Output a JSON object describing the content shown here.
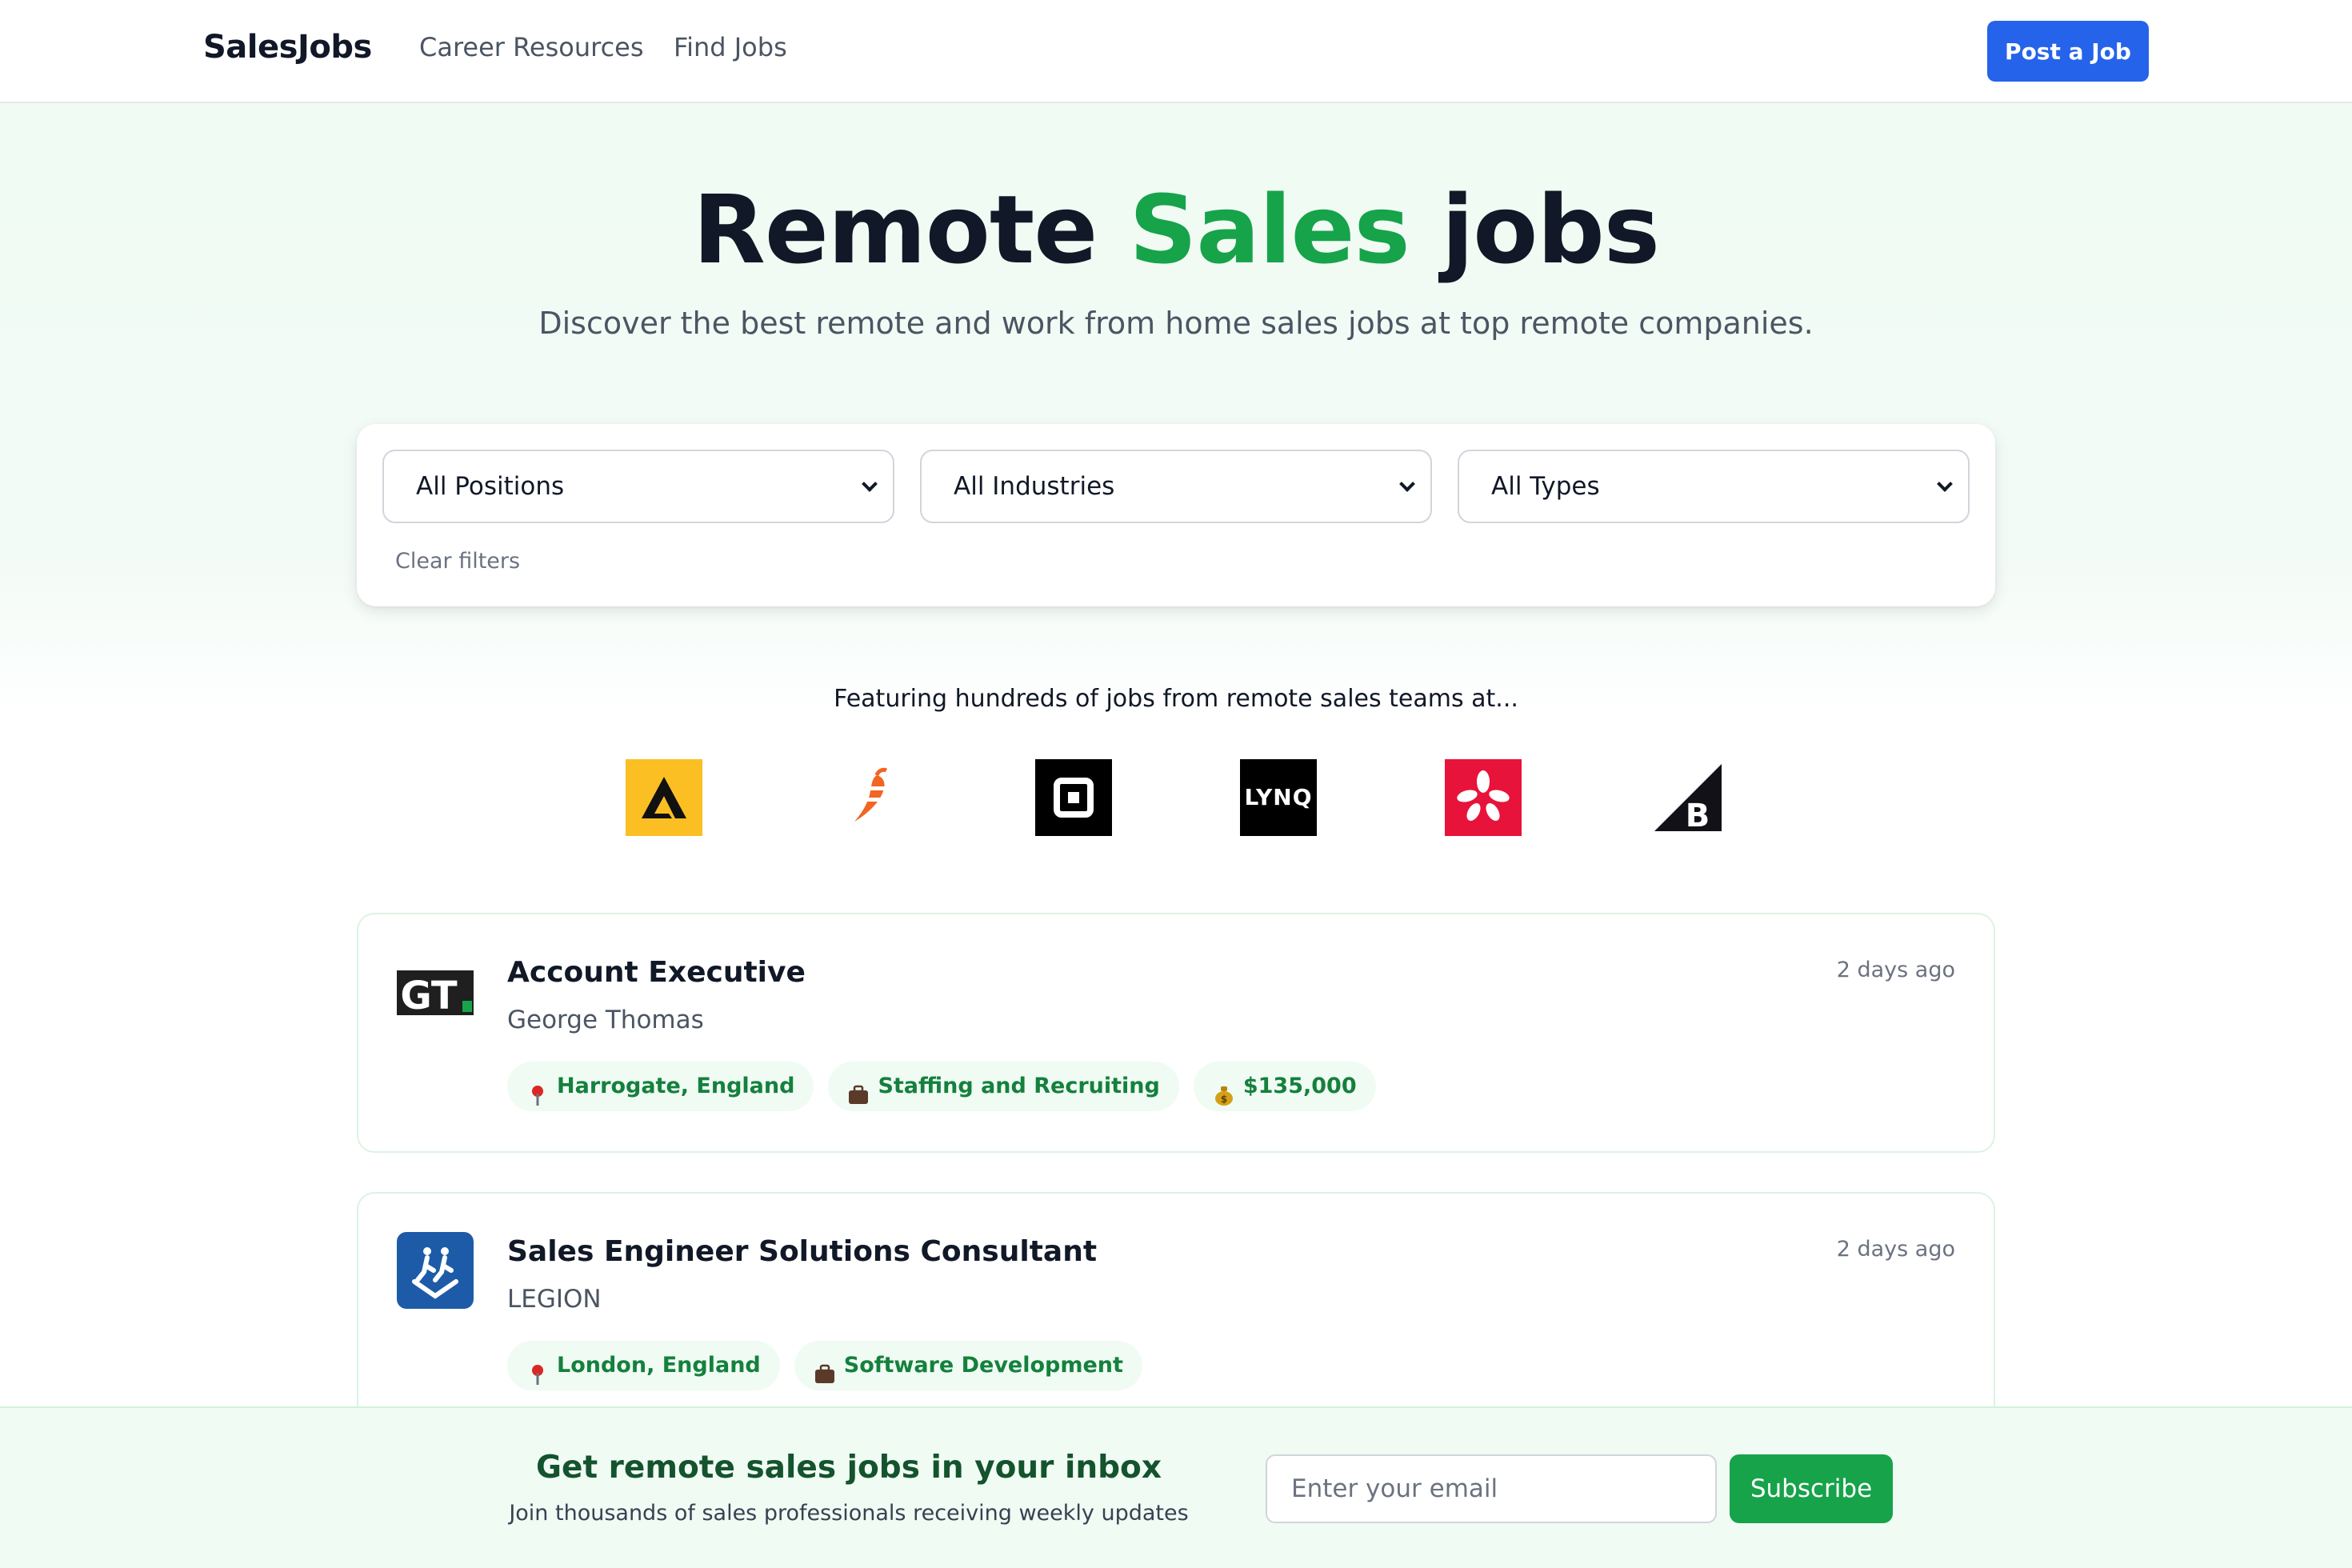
{
  "header": {
    "brand": "SalesJobs",
    "nav": [
      "Career Resources",
      "Find Jobs"
    ],
    "post_button": "Post a Job"
  },
  "hero": {
    "title_part1": "Remote",
    "title_accent": "Sales",
    "title_part2": "jobs",
    "subtitle": "Discover the best remote and work from home sales jobs at top remote companies."
  },
  "filters": {
    "position": "All Positions",
    "industry": "All Industries",
    "type": "All Types",
    "clear": "Clear filters"
  },
  "featuring": {
    "text": "Featuring hundreds of jobs from remote sales teams at...",
    "logos": [
      "arrow-a-logo",
      "pepper-logo",
      "square-logo",
      "lynq-logo",
      "yelp-logo",
      "bigcommerce-logo"
    ],
    "lynq_text": "LYNQ"
  },
  "jobs": [
    {
      "title": "Account Executive",
      "company": "George Thomas",
      "date": "2 days ago",
      "logo_text": "GT",
      "location": "Harrogate, England",
      "industry": "Staffing and Recruiting",
      "salary": "$135,000"
    },
    {
      "title": "Sales Engineer Solutions Consultant",
      "company": "LEGION",
      "date": "2 days ago",
      "location": "London, England",
      "industry": "Software Development"
    }
  ],
  "newsletter": {
    "title": "Get remote sales jobs in your inbox",
    "subtitle": "Join thousands of sales professionals receiving weekly updates",
    "placeholder": "Enter your email",
    "button": "Subscribe"
  },
  "colors": {
    "brand_green": "#16a34a",
    "primary_blue": "#2563eb",
    "tag_bg": "#effbf3"
  }
}
